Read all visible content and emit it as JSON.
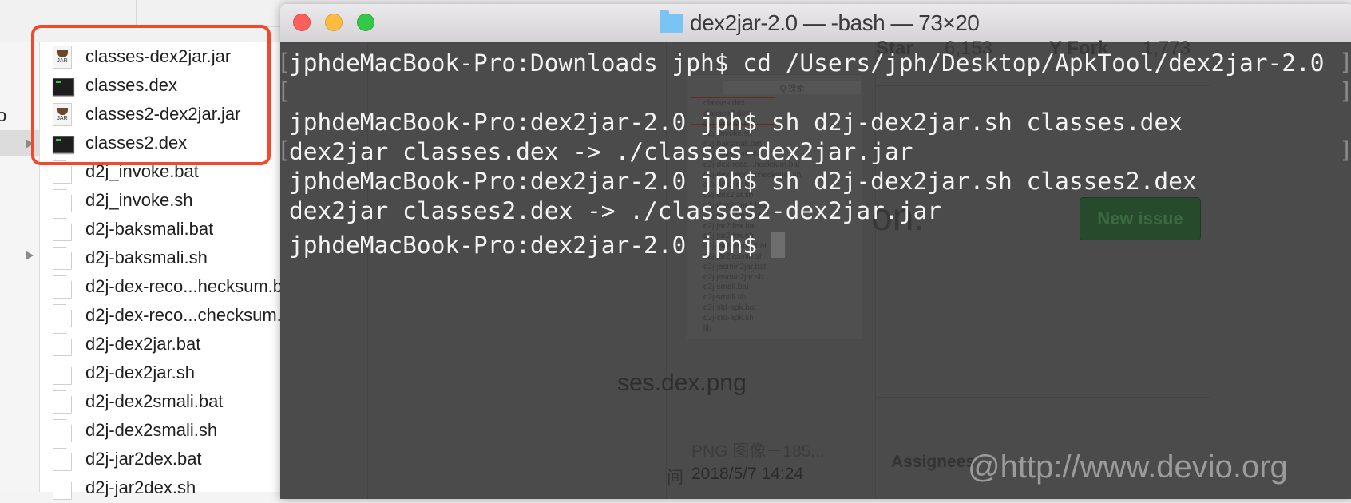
{
  "finder": {
    "sidebar_fragment": "o",
    "files": [
      {
        "name": "classes-dex2jar.jar",
        "icon": "jar-file-icon"
      },
      {
        "name": "classes.dex",
        "icon": "terminal-exec-icon"
      },
      {
        "name": "classes2-dex2jar.jar",
        "icon": "jar-file-icon"
      },
      {
        "name": "classes2.dex",
        "icon": "terminal-exec-icon"
      },
      {
        "name": "d2j_invoke.bat",
        "icon": "document-icon"
      },
      {
        "name": "d2j_invoke.sh",
        "icon": "document-icon"
      },
      {
        "name": "d2j-baksmali.bat",
        "icon": "document-icon"
      },
      {
        "name": "d2j-baksmali.sh",
        "icon": "document-icon"
      },
      {
        "name": "d2j-dex-reco...hecksum.bat",
        "icon": "document-icon"
      },
      {
        "name": "d2j-dex-reco...checksum.sh",
        "icon": "document-icon"
      },
      {
        "name": "d2j-dex2jar.bat",
        "icon": "document-icon"
      },
      {
        "name": "d2j-dex2jar.sh",
        "icon": "document-icon"
      },
      {
        "name": "d2j-dex2smali.bat",
        "icon": "document-icon"
      },
      {
        "name": "d2j-dex2smali.sh",
        "icon": "document-icon"
      },
      {
        "name": "d2j-jar2dex.bat",
        "icon": "document-icon"
      },
      {
        "name": "d2j-jar2dex.sh",
        "icon": "document-icon"
      }
    ],
    "jar_label": "JAR",
    "highlight_color": "#f2482c"
  },
  "terminal": {
    "title": "dex2jar-2.0 — -bash — 73×20",
    "lines": [
      "jphdeMacBook-Pro:Downloads jph$ cd /Users/jph/Desktop/ApkTool/dex2jar-2.0",
      "",
      "jphdeMacBook-Pro:dex2jar-2.0 jph$ sh d2j-dex2jar.sh classes.dex",
      "dex2jar classes.dex -> ./classes-dex2jar.jar",
      "jphdeMacBook-Pro:dex2jar-2.0 jph$ sh d2j-dex2jar.sh classes2.dex",
      "dex2jar classes2.dex -> ./classes2-dex2jar.jar",
      "jphdeMacBook-Pro:dex2jar-2.0 jph$ "
    ],
    "bracket_open": "[",
    "bracket_close": "]",
    "colors": {
      "background": "#4b4b4b",
      "text": "#f3f3f3",
      "close": "#fc605c",
      "minimize": "#fdbc40",
      "zoom": "#34c84a"
    }
  },
  "background_page": {
    "star_label": "Star",
    "star_count": "6,153",
    "fork_label": "Y Fork",
    "fork_count": "1,773",
    "heading_fragment": "on.",
    "new_issue": "New issue",
    "file_name_fragment": "ses.dex.png",
    "file_kind": "PNG 图像－185...",
    "time_label_fragment": "间",
    "time_value": "2018/5/7 14:24",
    "assignees": "Assignees",
    "mini_search": "Q 搜索",
    "mini_files": [
      "classes.dex",
      "classes2.dex",
      "d2j_invoke.bat",
      "d2j_invoke.sh",
      "d2j-baksmali.bat",
      "d2j-baksmali.sh",
      "d2j-dex-reco...hecksum.bat",
      "d2j-dex-reco...checksum.sh",
      "d2j-dex2jar.bat",
      "d2j-dex2jar.sh",
      "d2j-dex2smali.bat",
      "d2j-dex2smali.sh",
      "d2j-jar2dex.bat",
      "d2j-jar2dex.sh",
      "d2j-jar2jasmin.bat",
      "d2j-jar2jasmin.sh",
      "d2j-jasmin2jar.bat",
      "d2j-jasmin2jar.sh",
      "d2j-smali.bat",
      "d2j-smali.sh",
      "d2j-std-apk.bat",
      "d2j-std-apk.sh",
      "lib"
    ]
  },
  "watermark": "@http://www.devio.org"
}
